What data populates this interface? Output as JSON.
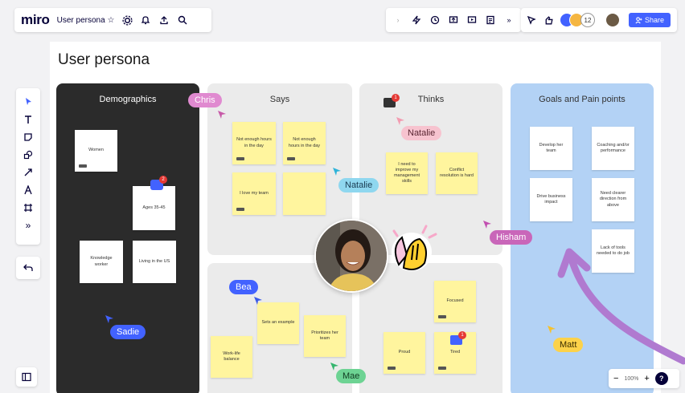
{
  "app": {
    "logo": "miro",
    "board_name": "User persona ☆"
  },
  "frame": {
    "title": "User persona"
  },
  "collab": {
    "extra_count": "12",
    "share_label": "Share"
  },
  "zoom": {
    "minus": "−",
    "level": "100%",
    "plus": "+",
    "help": "?"
  },
  "columns": {
    "demographics": "Demographics",
    "says": "Says",
    "thinks": "Thinks",
    "goals": "Goals and Pain points"
  },
  "notes": {
    "demo_1": "Women",
    "demo_2": "Ages 35-45",
    "demo_3": "Knowledge worker",
    "demo_4": "Living in the US",
    "says_1": "Not enough hours in the day",
    "says_2": "Not enough hours in the day",
    "says_3": "I love my team",
    "thinks_1": "I need to improve my management skills",
    "thinks_2": "Conflict resolution is hard",
    "feel_1": "Focused",
    "feel_2": "Proud",
    "feel_3": "Tired",
    "does_1": "Sets an example",
    "does_2": "Prioritizes her team",
    "does_3": "Work-life balance",
    "goal_1": "Develop her team",
    "goal_2": "Coaching and/or performance",
    "goal_3": "Drive business impact",
    "goal_4": "Need clearer direction from above",
    "goal_5": "Lack of tools needed to do job"
  },
  "cursors": {
    "chris": "Chris",
    "natalie_1": "Natalie",
    "natalie_2": "Natalie",
    "hisham": "Hisham",
    "bea": "Bea",
    "sadie": "Sadie",
    "mae": "Mae",
    "matt": "Matt"
  },
  "comments": {
    "demo_count": "2",
    "thinks_count": "1",
    "feel_count": "1"
  },
  "colors": {
    "dark_column": "#2b2b2b",
    "grey_column": "#ebebeb",
    "blue_column": "#b3d2f5",
    "sticky_yellow": "#fff59e",
    "brand_blue": "#4262ff",
    "arrow_purple": "#b07ad0"
  }
}
